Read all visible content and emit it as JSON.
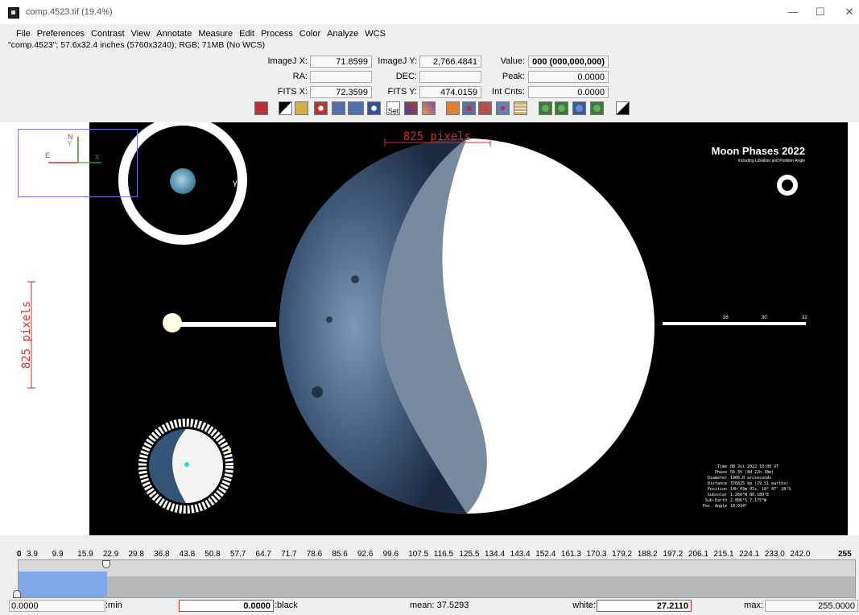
{
  "window": {
    "title": "comp.4523.tif (19.4%)",
    "minimize": "—",
    "maximize": "☐",
    "close": "✕"
  },
  "menu": [
    "File",
    "Preferences",
    "Contrast",
    "View",
    "Annotate",
    "Measure",
    "Edit",
    "Process",
    "Color",
    "Analyze",
    "WCS"
  ],
  "info_line": "\"comp.4523\"; 57.6x32.4 inches (5760x3240); RGB; 71MB (No WCS)",
  "readouts": {
    "imagej_x_label": "ImageJ X:",
    "imagej_x": "71.8599",
    "imagej_y_label": "ImageJ Y:",
    "imagej_y": "2,766.4841",
    "value_label": "Value:",
    "value": "000 (000,000,000)",
    "ra_label": "RA:",
    "ra": "",
    "dec_label": "DEC:",
    "dec": "",
    "peak_label": "Peak:",
    "peak": "0.0000",
    "fits_x_label": "FITS X:",
    "fits_x": "72.3599",
    "fits_y_label": "FITS Y:",
    "fits_y": "474.0159",
    "int_cnts_label": "Int Cnts:",
    "int_cnts": "0.0000"
  },
  "toolbar_icons": [
    "delete-icon",
    "layers-icon",
    "frame-icon",
    "aperture-icon",
    "aperture-1-icon",
    "aperture-2-icon",
    "aperture-ring-icon",
    "set-icon",
    "tools-icon",
    "color-tools-icon",
    "edit-icon",
    "circles-icon",
    "copy-icon",
    "crosshair-icon",
    "table-icon",
    "zoom-in-icon",
    "zoom-fit-icon",
    "zoom-out-icon",
    "zoom-reset-icon",
    "contrast-icon"
  ],
  "overlay": {
    "scale_top": "825 pixels",
    "scale_left": "825 pixels",
    "poster_title": "Moon Phases 2022",
    "poster_subtitle": "Including Libration and Position Angle",
    "compass_n": "N",
    "compass_y": "Y",
    "compass_e": "E",
    "compass_x": "X",
    "gamma": "γ",
    "timeline_labels": [
      "28",
      "30",
      "32"
    ],
    "stats": [
      [
        "Time",
        "08 Jul 2022 10:00 UT"
      ],
      [
        "Phase",
        "56.3% (8d 22h 38m)"
      ],
      [
        "Diameter",
        "1906.0 arcseconds"
      ],
      [
        "Distance",
        "376825 km (29.51 earths)"
      ],
      [
        "Position",
        "14h 43m 01s, 18° 47' 28\"S"
      ],
      [
        "Subsolar",
        "1.260°N 86.189°E"
      ],
      [
        "Sub-Earth",
        "2.086°S 7.175°W"
      ],
      [
        "Pos. Angle",
        "18.934°"
      ]
    ]
  },
  "histogram": {
    "ticks": [
      "0",
      "3.9",
      "9.9",
      "15.9",
      "22.9",
      "29.8",
      "36.8",
      "43.8",
      "50.8",
      "57.7",
      "64.7",
      "71.7",
      "78.6",
      "85.6",
      "92.6",
      "99.6",
      "107.5",
      "116.5",
      "125.5",
      "134.4",
      "143.4",
      "152.4",
      "161.3",
      "170.3",
      "179.2",
      "188.2",
      "197.2",
      "206.1",
      "215.1",
      "224.1",
      "233.0",
      "242.0",
      "255"
    ],
    "min_value": "0.0000",
    "min_label": ":min",
    "black_value": "0.0000",
    "black_label": ":black",
    "mean": "mean: 37.5293",
    "white_label": "white:",
    "white_value": "27.2110",
    "max_label": "max:",
    "max_value": "255.0000",
    "selection_color": "#7fa8e8"
  }
}
